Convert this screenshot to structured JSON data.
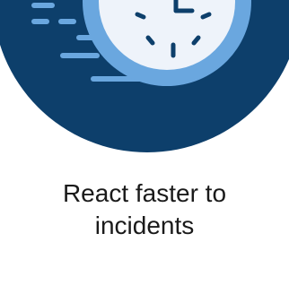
{
  "caption": {
    "line1": "React faster to",
    "line2": "incidents"
  },
  "icon": {
    "name": "fast-clock-icon",
    "colors": {
      "circle_bg": "#0d3f6b",
      "clock_ring": "#6aa7df",
      "clock_face": "#eef3fa",
      "clock_marks": "#0d3f6b",
      "speed_lines": "#6aa7df"
    }
  }
}
